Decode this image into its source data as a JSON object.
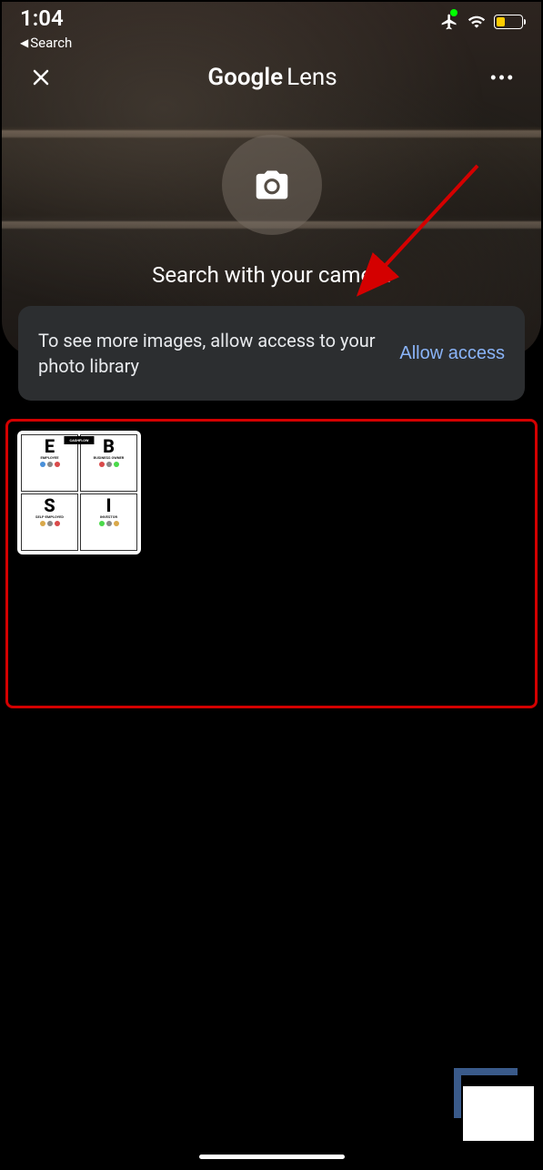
{
  "status_bar": {
    "time": "1:04",
    "back_label": "Search"
  },
  "header": {
    "title_bold": "Google",
    "title_light": "Lens"
  },
  "camera": {
    "prompt": "Search with your camera"
  },
  "permission": {
    "message": "To see more images, allow access to your photo library",
    "button": "Allow access"
  },
  "thumbnail": {
    "header": "CASHFLOW",
    "quadrants": [
      {
        "letter": "E",
        "label": "EMPLOYEE"
      },
      {
        "letter": "B",
        "label": "BUSINESS OWNER"
      },
      {
        "letter": "S",
        "label": "SELF-EMPLOYED"
      },
      {
        "letter": "I",
        "label": "INVESTOR"
      }
    ]
  }
}
